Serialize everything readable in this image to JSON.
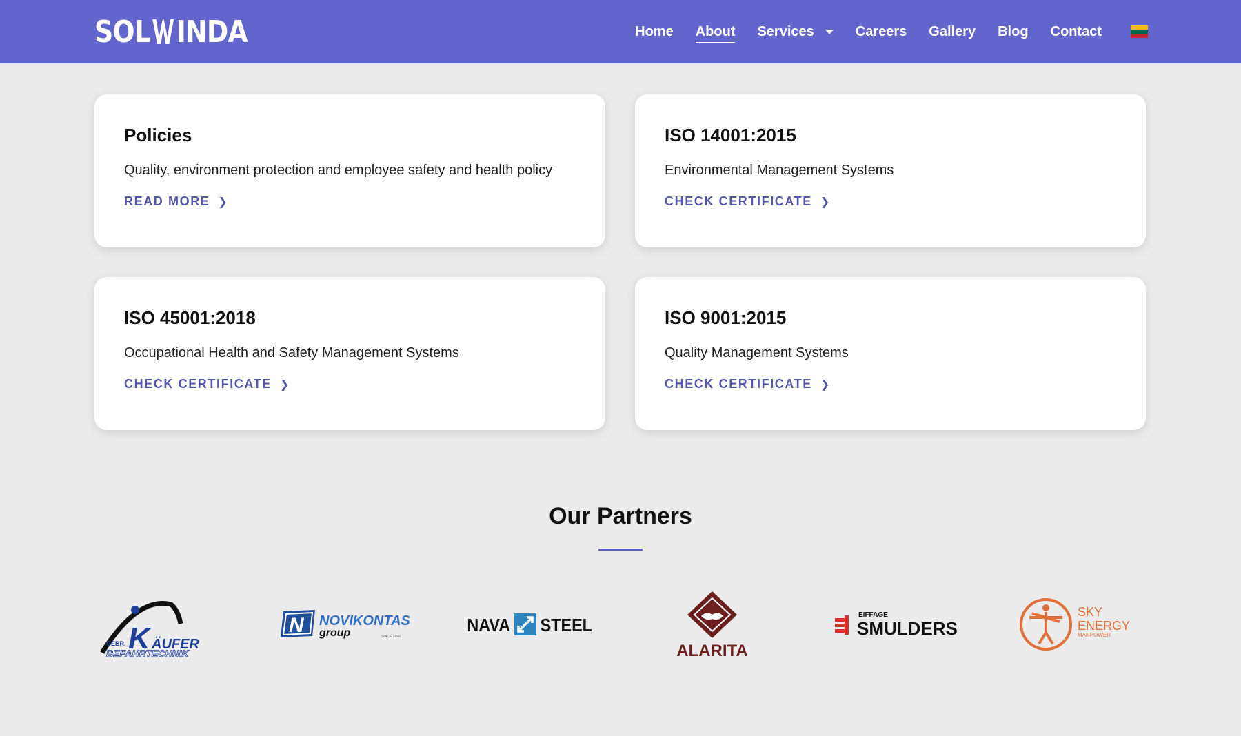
{
  "header": {
    "logo_text": "SOLWINDA",
    "nav": [
      {
        "label": "Home",
        "active": false
      },
      {
        "label": "About",
        "active": true
      },
      {
        "label": "Services",
        "active": false,
        "has_dropdown": true
      },
      {
        "label": "Careers",
        "active": false
      },
      {
        "label": "Gallery",
        "active": false
      },
      {
        "label": "Blog",
        "active": false
      },
      {
        "label": "Contact",
        "active": false
      }
    ],
    "language_flag": "lithuania-flag-icon",
    "colors": {
      "bar": "#6266cc",
      "flag": [
        "#fdb913",
        "#006a44",
        "#c1272d"
      ]
    }
  },
  "cards": [
    {
      "title": "Policies",
      "description": "Quality, environment protection and employee safety and health policy",
      "link": "READ MORE"
    },
    {
      "title": "ISO 14001:2015",
      "description": "Environmental Management Systems",
      "link": "CHECK CERTIFICATE"
    },
    {
      "title": "ISO 45001:2018",
      "description": "Occupational Health and Safety Management Systems",
      "link": "CHECK CERTIFICATE"
    },
    {
      "title": "ISO 9001:2015",
      "description": "Quality Management Systems",
      "link": "CHECK CERTIFICATE"
    }
  ],
  "partners": {
    "title": "Our Partners",
    "logos": [
      {
        "name": "kaufer-logo",
        "text_main": "KÄUFER",
        "text_prefix": "GEBR.",
        "text_sub": "BEFAHRTECHNIK"
      },
      {
        "name": "novikontas-logo",
        "text_main": "NOVIKONTAS",
        "text_sub": "group",
        "text_since": "SINCE 1990"
      },
      {
        "name": "nava-steel-logo",
        "text_left": "NAVA",
        "text_right": "STEEL"
      },
      {
        "name": "alarita-logo",
        "text_main": "ALARITA"
      },
      {
        "name": "smulders-logo",
        "text_top": "EIFFAGE",
        "text_main": "SMULDERS"
      },
      {
        "name": "sky-energy-logo",
        "text_line1": "SKY",
        "text_line2": "ENERGY",
        "text_line3": "MANPOWER"
      }
    ]
  },
  "accent_color": "#5557a8"
}
